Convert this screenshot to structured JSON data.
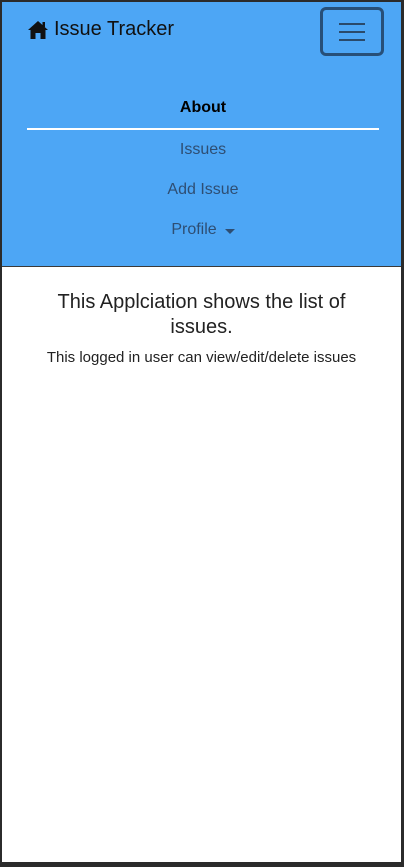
{
  "navbar": {
    "brand": {
      "icon": "home-icon",
      "title": "Issue Tracker"
    },
    "toggler": {
      "icon": "hamburger-menu-icon"
    },
    "items": [
      {
        "label": "About",
        "active": true
      },
      {
        "label": "Issues",
        "active": false
      },
      {
        "label": "Add Issue",
        "active": false
      },
      {
        "label": "Profile",
        "active": false,
        "dropdown": true
      }
    ],
    "colors": {
      "background": "#4da6f5",
      "link": "#2e4e73",
      "active_link": "#000000",
      "toggler_border": "#274f78"
    }
  },
  "main": {
    "heading": "This Applciation shows the list of issues.",
    "description": "This logged in user can view/edit/delete issues"
  }
}
